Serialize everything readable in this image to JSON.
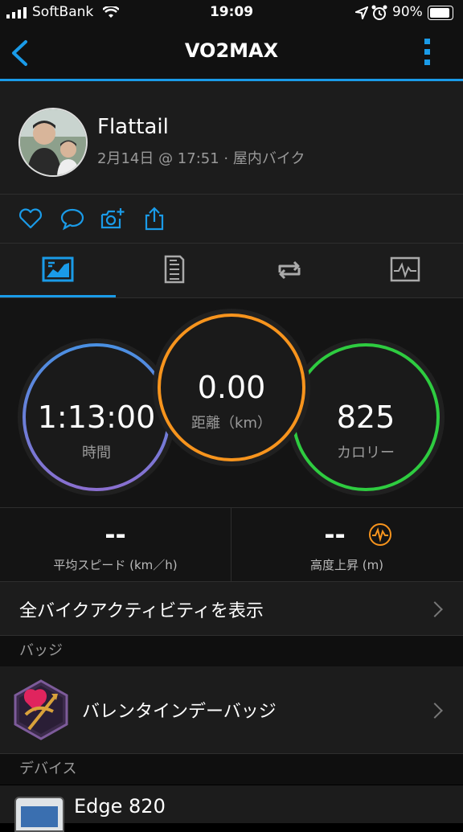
{
  "status_bar": {
    "carrier": "SoftBank",
    "time": "19:09",
    "battery": "90%"
  },
  "nav": {
    "title": "VO2MAX",
    "back_icon": "chevron-left-icon",
    "menu_icon": "more-vertical-icon"
  },
  "activity": {
    "user_name": "Flattail",
    "meta": "2月14日 @ 17:51 · 屋内バイク"
  },
  "actions": [
    "heart-icon",
    "comment-icon",
    "camera-add-icon",
    "share-icon"
  ],
  "tabs": [
    "stats-tab",
    "details-tab",
    "laps-tab",
    "charts-tab"
  ],
  "stats": {
    "time": {
      "value": "1:13:00",
      "label": "時間"
    },
    "distance": {
      "value": "0.00",
      "label": "距離（km）"
    },
    "calories": {
      "value": "825",
      "label": "カロリー"
    }
  },
  "metrics": {
    "avg_speed": {
      "value": "--",
      "label": "平均スピード (km／h)"
    },
    "elevation": {
      "value": "--",
      "label": "高度上昇 (m)"
    }
  },
  "all_bike_link": "全バイクアクティビティを表示",
  "badges": {
    "header": "バッジ",
    "badge_name": "バレンタインデーバッジ"
  },
  "devices": {
    "header": "デバイス",
    "device_name": "Edge 820"
  },
  "colors": {
    "accent": "#1a9be8",
    "time_ring": "#4a90e2",
    "distance_ring": "#f7941d",
    "calorie_ring": "#2ecc40"
  }
}
